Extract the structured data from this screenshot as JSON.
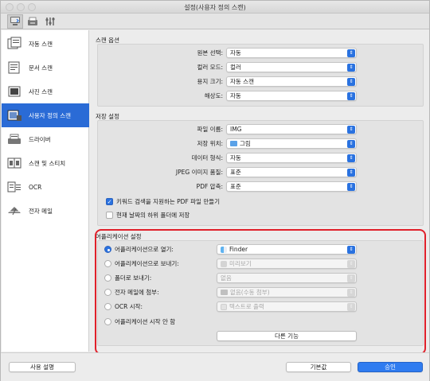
{
  "window": {
    "title": "설정(사용자 정의 스캔)"
  },
  "toolbar": {
    "tabs": [
      "scan-from-computer",
      "scan-from-panel",
      "general-settings"
    ]
  },
  "sidebar": {
    "items": [
      {
        "label": "자동 스캔",
        "icon": "auto-scan-icon"
      },
      {
        "label": "문서 스캔",
        "icon": "document-scan-icon"
      },
      {
        "label": "사진 스캔",
        "icon": "photo-scan-icon"
      },
      {
        "label": "사용자 정의 스캔",
        "icon": "custom-scan-icon",
        "selected": true
      },
      {
        "label": "드라이버",
        "icon": "driver-icon"
      },
      {
        "label": "스캔 및 스티치",
        "icon": "stitch-icon"
      },
      {
        "label": "OCR",
        "icon": "ocr-icon"
      },
      {
        "label": "전자 메일",
        "icon": "email-icon"
      }
    ]
  },
  "scan_options": {
    "title": "스캔 옵션",
    "source_label": "원본 선택:",
    "source_value": "자동",
    "color_label": "컬러 모드:",
    "color_value": "컬러",
    "paper_label": "용지 크기:",
    "paper_value": "자동 스캔",
    "resolution_label": "해상도:",
    "resolution_value": "자동"
  },
  "save_settings": {
    "title": "저장 설정",
    "filename_label": "파일 이름:",
    "filename_value": "IMG",
    "location_label": "저장 위치:",
    "location_value": "그림",
    "format_label": "데이터 형식:",
    "format_value": "자동",
    "jpeg_label": "JPEG 이미지 품질:",
    "jpeg_value": "표준",
    "pdf_label": "PDF 압축:",
    "pdf_value": "표준",
    "keyword_pdf": "키워드 검색을 지원하는 PDF 파일 만들기",
    "date_folder": "현재 날짜의 하위 폴더에 저장"
  },
  "app_settings": {
    "title": "어플리케이션 설정",
    "open_label": "어플리케이션으로 열기:",
    "open_value": "Finder",
    "send_label": "어플리케이션으로 보내기:",
    "send_value": "미리보기",
    "folder_label": "폴더로 보내기:",
    "folder_value": "없음",
    "email_label": "전자 메일에 첨부:",
    "email_value": "없음(수동 첨부)",
    "ocr_label": "OCR 시작:",
    "ocr_value": "텍스트로 출력",
    "none_label": "어플리케이션 시작 안 함",
    "more_button": "다른 기능"
  },
  "footer": {
    "help_button": "사용 설명",
    "defaults_button": "기본값",
    "ok_button": "승인"
  },
  "colors": {
    "accent": "#2a72e0",
    "highlight": "#e0202a"
  }
}
